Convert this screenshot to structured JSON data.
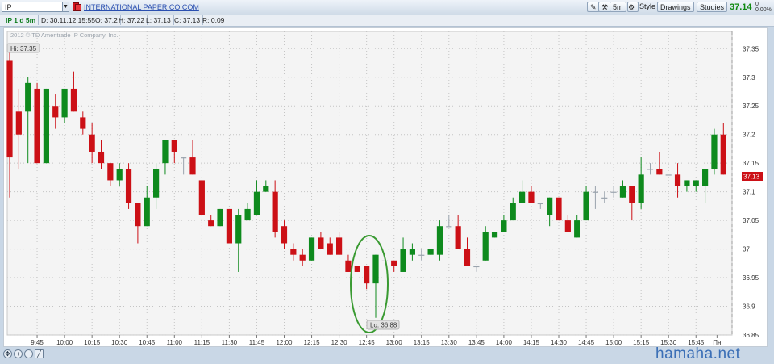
{
  "toolbar": {
    "symbol": "IP",
    "company": "INTERNATIONAL PAPER CO COM",
    "interval_button": "5m",
    "style_label": "Style",
    "drawings_label": "Drawings",
    "studies_label": "Studies",
    "last_price": "37.14",
    "change_top": "0",
    "change_bottom": "0.00%"
  },
  "info": {
    "title": "IP 1 d 5m",
    "date": "D: 30.11.12 15:55",
    "open": "O: 37.2",
    "high": "H: 37.22",
    "low": "L: 37.13",
    "close": "C: 37.13",
    "range": "R: 0.09"
  },
  "copyright": "2012 © TD Ameritrade IP Company, Inc.",
  "hi_label": "Hi: 37.35",
  "lo_label": "Lo: 36.88",
  "price_tag": "37.13",
  "watermark": "hamaha.net",
  "colors": {
    "up": "#0e8a1d",
    "down": "#cc1016",
    "tag": "#cc1016",
    "ellipse": "#3a9a32"
  },
  "chart_data": {
    "type": "candlestick",
    "title": "",
    "xlabel": "",
    "ylabel": "",
    "ylim": [
      36.85,
      37.38
    ],
    "y_ticks": [
      "36.85",
      "36.9",
      "36.95",
      "37",
      "37.05",
      "37.1",
      "37.15",
      "37.2",
      "37.25",
      "37.3",
      "37.35"
    ],
    "x_ticks": [
      {
        "i": 3,
        "label": "9:45"
      },
      {
        "i": 6,
        "label": "10:00"
      },
      {
        "i": 9,
        "label": "10:15"
      },
      {
        "i": 12,
        "label": "10:30"
      },
      {
        "i": 15,
        "label": "10:45"
      },
      {
        "i": 18,
        "label": "11:00"
      },
      {
        "i": 21,
        "label": "11:15"
      },
      {
        "i": 24,
        "label": "11:30"
      },
      {
        "i": 27,
        "label": "11:45"
      },
      {
        "i": 30,
        "label": "12:00"
      },
      {
        "i": 33,
        "label": "12:15"
      },
      {
        "i": 36,
        "label": "12:30"
      },
      {
        "i": 39,
        "label": "12:45"
      },
      {
        "i": 42,
        "label": "13:00"
      },
      {
        "i": 45,
        "label": "13:15"
      },
      {
        "i": 48,
        "label": "13:30"
      },
      {
        "i": 51,
        "label": "13:45"
      },
      {
        "i": 54,
        "label": "14:00"
      },
      {
        "i": 57,
        "label": "14:15"
      },
      {
        "i": 60,
        "label": "14:30"
      },
      {
        "i": 63,
        "label": "14:45"
      },
      {
        "i": 66,
        "label": "15:00"
      },
      {
        "i": 69,
        "label": "15:15"
      },
      {
        "i": 72,
        "label": "15:30"
      },
      {
        "i": 75,
        "label": "15:45"
      },
      {
        "i": 77.3,
        "label": "Пн"
      }
    ],
    "candles": [
      {
        "o": 37.33,
        "h": 37.35,
        "l": 37.09,
        "c": 37.16
      },
      {
        "o": 37.24,
        "h": 37.28,
        "l": 37.14,
        "c": 37.2
      },
      {
        "o": 37.24,
        "h": 37.3,
        "l": 37.15,
        "c": 37.29
      },
      {
        "o": 37.28,
        "h": 37.29,
        "l": 37.15,
        "c": 37.15
      },
      {
        "o": 37.15,
        "h": 37.28,
        "l": 37.15,
        "c": 37.28
      },
      {
        "o": 37.25,
        "h": 37.27,
        "l": 37.21,
        "c": 37.23
      },
      {
        "o": 37.23,
        "h": 37.28,
        "l": 37.22,
        "c": 37.28
      },
      {
        "o": 37.28,
        "h": 37.31,
        "l": 37.24,
        "c": 37.24
      },
      {
        "o": 37.23,
        "h": 37.24,
        "l": 37.2,
        "c": 37.21
      },
      {
        "o": 37.2,
        "h": 37.22,
        "l": 37.15,
        "c": 37.17
      },
      {
        "o": 37.17,
        "h": 37.19,
        "l": 37.14,
        "c": 37.15
      },
      {
        "o": 37.15,
        "h": 37.15,
        "l": 37.11,
        "c": 37.12
      },
      {
        "o": 37.12,
        "h": 37.15,
        "l": 37.11,
        "c": 37.14
      },
      {
        "o": 37.14,
        "h": 37.15,
        "l": 37.07,
        "c": 37.08
      },
      {
        "o": 37.08,
        "h": 37.08,
        "l": 37.01,
        "c": 37.04
      },
      {
        "o": 37.04,
        "h": 37.11,
        "l": 37.04,
        "c": 37.09
      },
      {
        "o": 37.09,
        "h": 37.15,
        "l": 37.07,
        "c": 37.14
      },
      {
        "o": 37.15,
        "h": 37.19,
        "l": 37.13,
        "c": 37.19
      },
      {
        "o": 37.19,
        "h": 37.19,
        "l": 37.15,
        "c": 37.17
      },
      {
        "o": 37.16,
        "h": 37.16,
        "l": 37.13,
        "c": 37.16
      },
      {
        "o": 37.16,
        "h": 37.19,
        "l": 37.13,
        "c": 37.13
      },
      {
        "o": 37.12,
        "h": 37.12,
        "l": 37.06,
        "c": 37.06
      },
      {
        "o": 37.05,
        "h": 37.06,
        "l": 37.04,
        "c": 37.04
      },
      {
        "o": 37.04,
        "h": 37.07,
        "l": 37.04,
        "c": 37.07
      },
      {
        "o": 37.07,
        "h": 37.07,
        "l": 37.01,
        "c": 37.01
      },
      {
        "o": 37.01,
        "h": 37.07,
        "l": 36.96,
        "c": 37.06
      },
      {
        "o": 37.05,
        "h": 37.08,
        "l": 37.05,
        "c": 37.07
      },
      {
        "o": 37.06,
        "h": 37.12,
        "l": 37.06,
        "c": 37.1
      },
      {
        "o": 37.1,
        "h": 37.12,
        "l": 37.1,
        "c": 37.11
      },
      {
        "o": 37.1,
        "h": 37.12,
        "l": 37.02,
        "c": 37.03
      },
      {
        "o": 37.04,
        "h": 37.05,
        "l": 37.0,
        "c": 37.01
      },
      {
        "o": 37.0,
        "h": 37.01,
        "l": 36.98,
        "c": 36.99
      },
      {
        "o": 36.99,
        "h": 37.0,
        "l": 36.97,
        "c": 36.98
      },
      {
        "o": 36.98,
        "h": 37.02,
        "l": 36.98,
        "c": 37.02
      },
      {
        "o": 37.02,
        "h": 37.03,
        "l": 37.0,
        "c": 37.0
      },
      {
        "o": 37.01,
        "h": 37.02,
        "l": 36.99,
        "c": 36.99
      },
      {
        "o": 37.02,
        "h": 37.03,
        "l": 36.99,
        "c": 36.99
      },
      {
        "o": 36.98,
        "h": 36.99,
        "l": 36.96,
        "c": 36.96
      },
      {
        "o": 36.97,
        "h": 36.97,
        "l": 36.96,
        "c": 36.96
      },
      {
        "o": 36.97,
        "h": 36.97,
        "l": 36.93,
        "c": 36.94
      },
      {
        "o": 36.94,
        "h": 36.99,
        "l": 36.88,
        "c": 36.99
      },
      {
        "o": 36.98,
        "h": 36.98,
        "l": 36.98,
        "c": 36.98
      },
      {
        "o": 36.98,
        "h": 36.98,
        "l": 36.96,
        "c": 36.97
      },
      {
        "o": 36.96,
        "h": 37.02,
        "l": 36.96,
        "c": 37.0
      },
      {
        "o": 36.99,
        "h": 37.01,
        "l": 36.98,
        "c": 37.0
      },
      {
        "o": 36.99,
        "h": 37.0,
        "l": 36.98,
        "c": 36.99
      },
      {
        "o": 36.99,
        "h": 37.0,
        "l": 36.99,
        "c": 37.0
      },
      {
        "o": 36.99,
        "h": 37.05,
        "l": 36.98,
        "c": 37.04
      },
      {
        "o": 37.04,
        "h": 37.06,
        "l": 37.04,
        "c": 37.04
      },
      {
        "o": 37.04,
        "h": 37.06,
        "l": 37.0,
        "c": 37.0
      },
      {
        "o": 37.0,
        "h": 37.02,
        "l": 36.97,
        "c": 36.97
      },
      {
        "o": 36.97,
        "h": 36.97,
        "l": 36.96,
        "c": 36.97
      },
      {
        "o": 36.98,
        "h": 37.04,
        "l": 36.98,
        "c": 37.03
      },
      {
        "o": 37.02,
        "h": 37.03,
        "l": 37.02,
        "c": 37.03
      },
      {
        "o": 37.03,
        "h": 37.06,
        "l": 37.03,
        "c": 37.05
      },
      {
        "o": 37.05,
        "h": 37.09,
        "l": 37.05,
        "c": 37.08
      },
      {
        "o": 37.08,
        "h": 37.12,
        "l": 37.08,
        "c": 37.1
      },
      {
        "o": 37.1,
        "h": 37.11,
        "l": 37.09,
        "c": 37.08
      },
      {
        "o": 37.08,
        "h": 37.08,
        "l": 37.07,
        "c": 37.08
      },
      {
        "o": 37.06,
        "h": 37.09,
        "l": 37.04,
        "c": 37.09
      },
      {
        "o": 37.09,
        "h": 37.09,
        "l": 37.05,
        "c": 37.05
      },
      {
        "o": 37.05,
        "h": 37.06,
        "l": 37.03,
        "c": 37.03
      },
      {
        "o": 37.02,
        "h": 37.06,
        "l": 37.02,
        "c": 37.05
      },
      {
        "o": 37.05,
        "h": 37.11,
        "l": 37.05,
        "c": 37.1
      },
      {
        "o": 37.1,
        "h": 37.11,
        "l": 37.07,
        "c": 37.1
      },
      {
        "o": 37.09,
        "h": 37.1,
        "l": 37.08,
        "c": 37.09
      },
      {
        "o": 37.1,
        "h": 37.11,
        "l": 37.09,
        "c": 37.1
      },
      {
        "o": 37.09,
        "h": 37.12,
        "l": 37.09,
        "c": 37.11
      },
      {
        "o": 37.11,
        "h": 37.11,
        "l": 37.05,
        "c": 37.08
      },
      {
        "o": 37.08,
        "h": 37.16,
        "l": 37.07,
        "c": 37.13
      },
      {
        "o": 37.14,
        "h": 37.15,
        "l": 37.13,
        "c": 37.14
      },
      {
        "o": 37.14,
        "h": 37.17,
        "l": 37.13,
        "c": 37.13
      },
      {
        "o": 37.13,
        "h": 37.13,
        "l": 37.13,
        "c": 37.13
      },
      {
        "o": 37.13,
        "h": 37.15,
        "l": 37.09,
        "c": 37.11
      },
      {
        "o": 37.11,
        "h": 37.12,
        "l": 37.1,
        "c": 37.12
      },
      {
        "o": 37.11,
        "h": 37.12,
        "l": 37.1,
        "c": 37.12
      },
      {
        "o": 37.11,
        "h": 37.13,
        "l": 37.08,
        "c": 37.14
      },
      {
        "o": 37.14,
        "h": 37.21,
        "l": 37.13,
        "c": 37.2
      },
      {
        "o": 37.2,
        "h": 37.22,
        "l": 37.13,
        "c": 37.13
      }
    ]
  }
}
